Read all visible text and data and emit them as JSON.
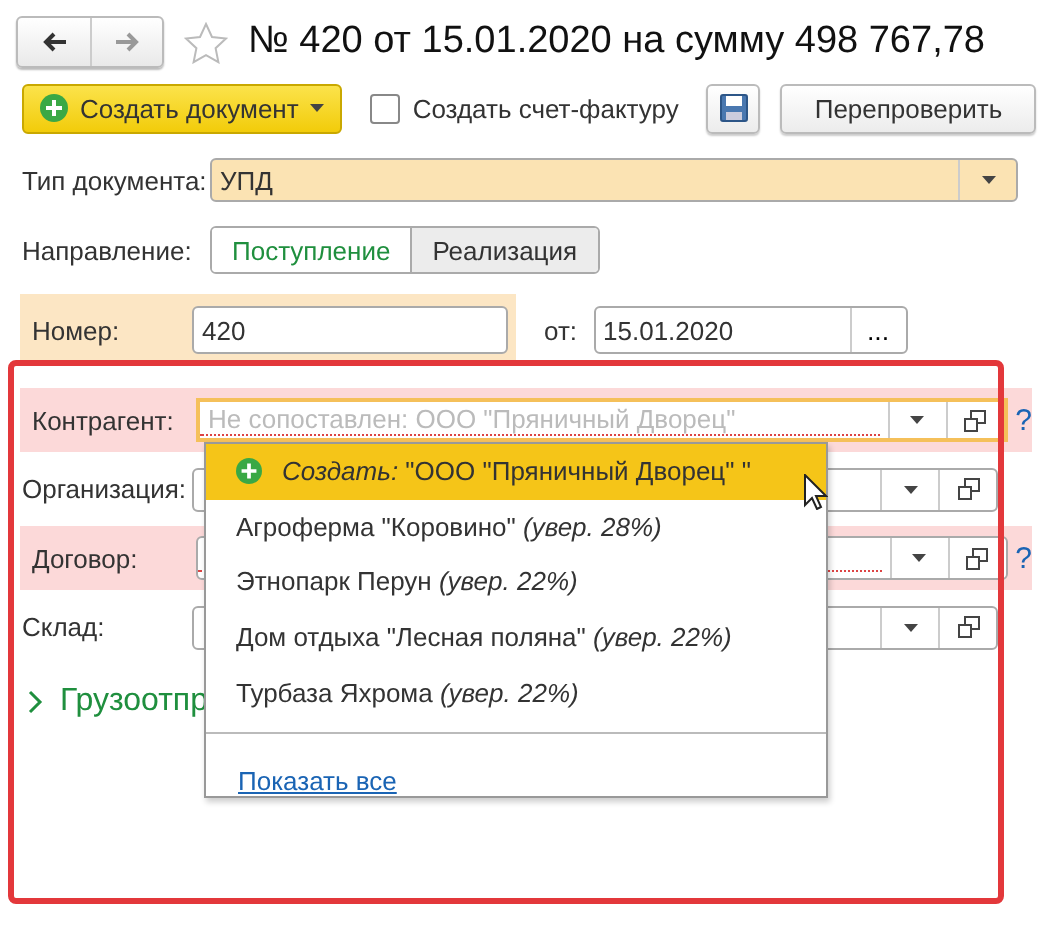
{
  "nav": {
    "back_enabled": true,
    "forward_enabled": false
  },
  "favorite": false,
  "title": "№ 420 от 15.01.2020 на сумму 498 767,78",
  "toolbar": {
    "create_button": "Создать документ",
    "invoice_checkbox": {
      "label": "Создать счет-фактуру",
      "checked": false
    },
    "recheck_button": "Перепроверить"
  },
  "doc_type": {
    "label": "Тип документа:",
    "value": "УПД"
  },
  "direction": {
    "label": "Направление:",
    "options": [
      {
        "label": "Поступление",
        "selected": true
      },
      {
        "label": "Реализация",
        "selected": false
      }
    ]
  },
  "number": {
    "label": "Номер:",
    "value": "420"
  },
  "date": {
    "label": "от:",
    "value": "15.01.2020",
    "button": "..."
  },
  "links": [
    {
      "label": "Контрагент:",
      "placeholder": "Не сопоставлен: ООО \"Пряничный Дворец\"",
      "error": true,
      "focused": true,
      "help": "?"
    },
    {
      "label": "Организация:",
      "error": false,
      "focused": false
    },
    {
      "label": "Договор:",
      "error": true,
      "focused": false,
      "help": "?"
    },
    {
      "label": "Склад:",
      "error": false,
      "focused": false
    }
  ],
  "group": {
    "label": "Грузоотпр",
    "expanded": false
  },
  "popup": {
    "items": [
      {
        "kind": "create",
        "text": "*Создать:* \"ООО \"Пряничный Дворец\" \"",
        "selected": true
      },
      {
        "kind": "match",
        "text": "Агроферма \"Коровино\" *(увер. 28%)*",
        "selected": false
      },
      {
        "kind": "match",
        "text": "Этнопарк Перун *(увер. 22%)*",
        "selected": false
      },
      {
        "kind": "match",
        "text": "Дом отдыха \"Лесная поляна\" *(увер. 22%)*",
        "selected": false
      },
      {
        "kind": "match",
        "text": "Турбаза Яхрома *(увер. 22%)*",
        "selected": false
      }
    ],
    "show_all": "Показать все"
  }
}
